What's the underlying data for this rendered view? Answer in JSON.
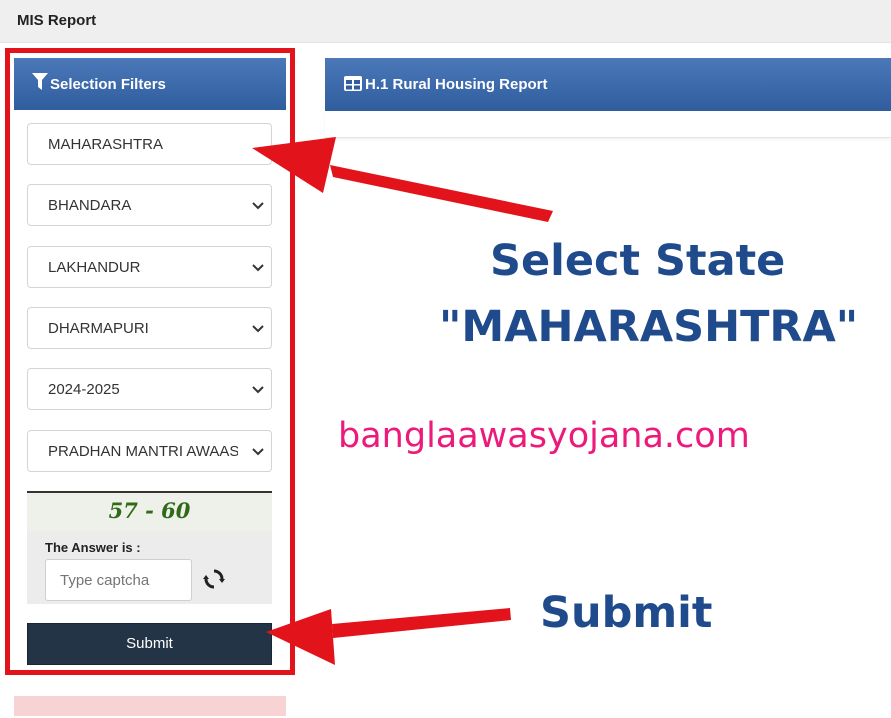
{
  "header": {
    "title": "MIS Report"
  },
  "filters": {
    "title": "Selection Filters",
    "state": "MAHARASHTRA",
    "district": "BHANDARA",
    "block": "LAKHANDUR",
    "panchayat": "DHARMAPURI",
    "year": "2024-2025",
    "scheme": "PRADHAN MANTRI AWAAS YOJANA"
  },
  "captcha": {
    "question": "57 - 60",
    "answer_label": "The Answer is :",
    "placeholder": "Type captcha"
  },
  "submit_label": "Submit",
  "report": {
    "title": "H.1 Rural Housing Report"
  },
  "annotations": {
    "state_line1": "Select State",
    "state_line2": "\"MAHARASHTRA\"",
    "website": "banglaawasyojana.com",
    "submit": "Submit"
  },
  "colors": {
    "header_blue": "#2f5d9e",
    "annotation_red": "#e3131b",
    "annotation_blue": "#1f4a8c",
    "website_pink": "#ec1b7b",
    "submit_bg": "#243447"
  }
}
